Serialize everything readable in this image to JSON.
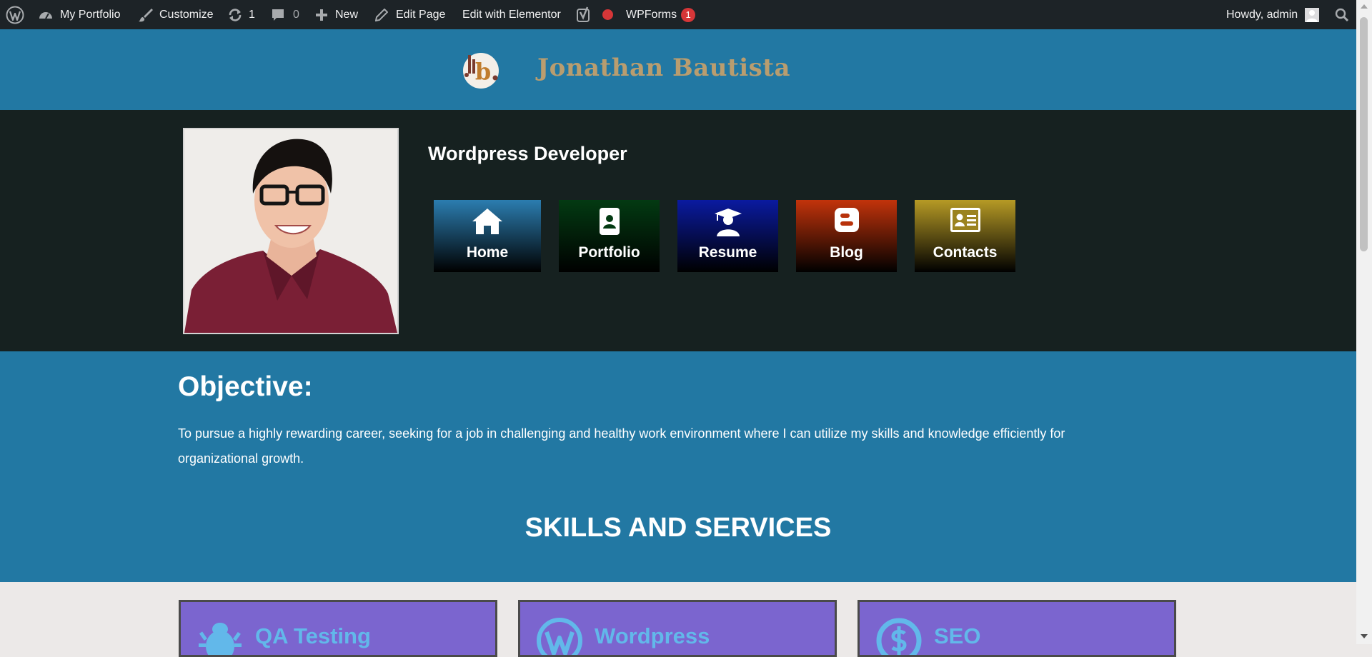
{
  "admin_bar": {
    "site_name": "My Portfolio",
    "customize": "Customize",
    "updates_count": "1",
    "comments_count": "0",
    "new": "New",
    "edit_page": "Edit Page",
    "edit_elementor": "Edit with Elementor",
    "wpforms": "WPForms",
    "wpforms_count": "1",
    "howdy": "Howdy, admin"
  },
  "header": {
    "site_title": "Jonathan Bautista",
    "logo_letter": "b"
  },
  "hero": {
    "job_title": "Wordpress Developer",
    "nav": [
      {
        "label": "Home",
        "icon": "home-icon"
      },
      {
        "label": "Portfolio",
        "icon": "portfolio-icon"
      },
      {
        "label": "Resume",
        "icon": "graduate-icon"
      },
      {
        "label": "Blog",
        "icon": "blogger-icon"
      },
      {
        "label": "Contacts",
        "icon": "contact-card-icon"
      }
    ]
  },
  "objective": {
    "heading": "Objective:",
    "text": "To pursue a highly rewarding career, seeking for a job in challenging and healthy work environment where I can utilize my skills and knowledge efficiently for organizational growth."
  },
  "skills": {
    "heading": "SKILLS AND SERVICES",
    "cards": [
      {
        "title": "QA Testing",
        "icon": "bug-icon"
      },
      {
        "title": "Wordpress",
        "icon": "wordpress-icon"
      },
      {
        "title": "SEO",
        "icon": "dollar-icon"
      }
    ]
  },
  "colors": {
    "admin_bar": "#1d2327",
    "header_bg": "#2278a3",
    "hero_bg": "#162120",
    "title_gold": "#b99d6f",
    "card_purple": "#7b65cf",
    "card_title_blue": "#62b8ea"
  }
}
